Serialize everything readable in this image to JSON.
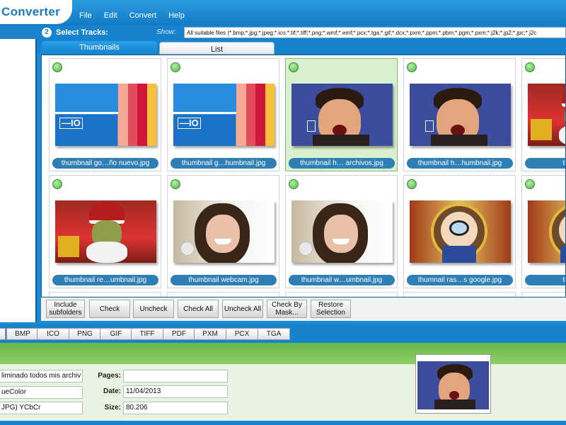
{
  "app": {
    "title": "Converter"
  },
  "menu": [
    "File",
    "Edit",
    "Convert",
    "Help"
  ],
  "step": {
    "number": "2",
    "label": "Select Tracks:",
    "show_label": "Show:",
    "filter": "All suitable files (*.bmp;*.jpg;*.jpeg;*.ico;*.tif;*.tiff;*.png;*.wmf;*.emf;*.pcx;*.tga;*.gif;*.dcx;*.pxm;*.ppm;*.pbm;*.pgm;*.pxm;*.j2k;*.jp2;*.jpc;*.j2c"
  },
  "tabs": {
    "thumbnails": "Thumbnails",
    "list": "List"
  },
  "thumbnails": [
    {
      "caption": "thumbnail go…ño nuevo.jpg",
      "art": "ico",
      "selected": false
    },
    {
      "caption": "thumbnail g…humbnail.jpg",
      "art": "ico",
      "selected": false
    },
    {
      "caption": "thumbnail h… archivos.jpg",
      "art": "kid",
      "selected": true
    },
    {
      "caption": "thumbnail h…humbnail.jpg",
      "art": "kid",
      "selected": false
    },
    {
      "caption": "thumbnail",
      "art": "santa",
      "selected": false
    },
    {
      "caption": "thumbnail re…umbnail.jpg",
      "art": "santa",
      "selected": false
    },
    {
      "caption": "thumbnail webcam.jpg",
      "art": "girl",
      "selected": false
    },
    {
      "caption": "thumbnail w…umbnail.jpg",
      "art": "girl",
      "selected": false
    },
    {
      "caption": "thumnail ras…s google.jpg",
      "art": "conan",
      "selected": false
    },
    {
      "caption": "thumbnail",
      "art": "conan",
      "selected": false
    }
  ],
  "buttons": {
    "include_subfolders": "Include subfolders",
    "check": "Check",
    "uncheck": "Uncheck",
    "check_all": "Check All",
    "uncheck_all": "Uncheck All",
    "check_by_mask": "Check By Mask...",
    "restore_selection": "Restore Selection"
  },
  "formats": [
    "BMP",
    "ICO",
    "PNG",
    "GIF",
    "TIFF",
    "PDF",
    "PXM",
    "PCX",
    "TGA"
  ],
  "info": {
    "name": "liminado todos mis archiv",
    "color": "ueColor",
    "compression": "JPG) YCbCr",
    "pages_label": "Pages:",
    "pages_value": "",
    "date_label": "Date:",
    "date_value": "11/04/2013",
    "size_label": "Size:",
    "size_value": "80.206"
  }
}
